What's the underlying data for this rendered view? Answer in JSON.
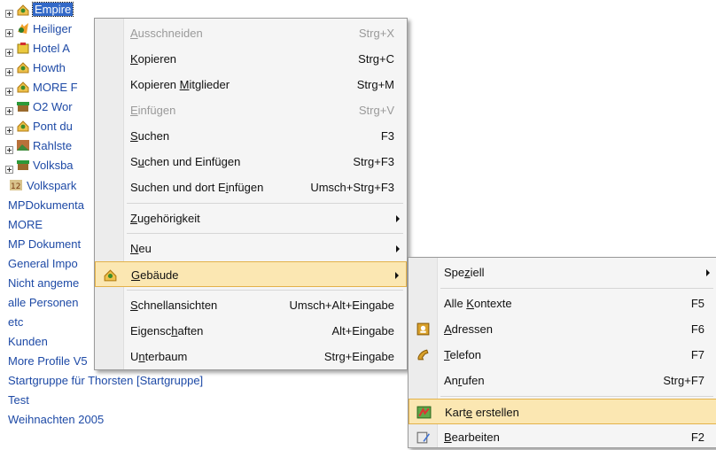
{
  "tree": {
    "items": [
      {
        "label": "Empire",
        "selected": true
      },
      {
        "label": "Heiliger"
      },
      {
        "label": "Hotel A"
      },
      {
        "label": "Howth"
      },
      {
        "label": "MORE F"
      },
      {
        "label": "O2 Wor"
      },
      {
        "label": "Pont du"
      },
      {
        "label": "Rahlste"
      },
      {
        "label": "Volksba"
      },
      {
        "label": "Volkspark"
      },
      {
        "label": "MPDokumenta"
      },
      {
        "label": "MORE"
      },
      {
        "label": "MP Dokument"
      },
      {
        "label": "General Impo"
      },
      {
        "label": "Nicht angeme"
      },
      {
        "label": "alle Personen"
      },
      {
        "label": "etc"
      },
      {
        "label": "Kunden"
      },
      {
        "label": "More Profile V5"
      },
      {
        "label": "Startgruppe für Thorsten [Startgruppe]"
      },
      {
        "label": "Test"
      },
      {
        "label": "Weihnachten 2005"
      }
    ]
  },
  "context_menu": {
    "items": [
      {
        "label_pre": "",
        "label_u": "A",
        "label_post": "usschneiden",
        "shortcut": "Strg+X",
        "disabled": true
      },
      {
        "label_pre": "",
        "label_u": "K",
        "label_post": "opieren",
        "shortcut": "Strg+C"
      },
      {
        "label_pre": "Kopieren ",
        "label_u": "M",
        "label_post": "itglieder",
        "shortcut": "Strg+M"
      },
      {
        "label_pre": "",
        "label_u": "E",
        "label_post": "infügen",
        "shortcut": "Strg+V",
        "disabled": true
      },
      {
        "label_pre": "",
        "label_u": "S",
        "label_post": "uchen",
        "shortcut": "F3"
      },
      {
        "label_pre": "S",
        "label_u": "u",
        "label_post": "chen und Einfügen",
        "shortcut": "Strg+F3"
      },
      {
        "label_pre": "Suchen und dort E",
        "label_u": "i",
        "label_post": "nfügen",
        "shortcut": "Umsch+Strg+F3"
      },
      {
        "label_pre": "",
        "label_u": "Z",
        "label_post": "ugehörigkeit",
        "shortcut": ""
      },
      {
        "label_pre": "",
        "label_u": "N",
        "label_post": "eu",
        "shortcut": ""
      },
      {
        "label_pre": "",
        "label_u": "G",
        "label_post": "ebäude",
        "shortcut": ""
      },
      {
        "label_pre": "",
        "label_u": "S",
        "label_post": "chnellansichten",
        "shortcut": "Umsch+Alt+Eingabe"
      },
      {
        "label_pre": "Eigensc",
        "label_u": "h",
        "label_post": "aften",
        "shortcut": "Alt+Eingabe"
      },
      {
        "label_pre": "U",
        "label_u": "n",
        "label_post": "terbaum",
        "shortcut": "Strg+Eingabe"
      }
    ]
  },
  "submenu": {
    "items": [
      {
        "label_pre": "Spe",
        "label_u": "z",
        "label_post": "iell",
        "shortcut": ""
      },
      {
        "label_pre": "Alle ",
        "label_u": "K",
        "label_post": "ontexte",
        "shortcut": "F5"
      },
      {
        "label_pre": "",
        "label_u": "A",
        "label_post": "dressen",
        "shortcut": "F6"
      },
      {
        "label_pre": "",
        "label_u": "T",
        "label_post": "elefon",
        "shortcut": "F7"
      },
      {
        "label_pre": "An",
        "label_u": "r",
        "label_post": "ufen",
        "shortcut": "Strg+F7"
      },
      {
        "label_pre": "Kart",
        "label_u": "e",
        "label_post": " erstellen",
        "shortcut": ""
      },
      {
        "label_pre": "",
        "label_u": "B",
        "label_post": "earbeiten",
        "shortcut": "F2"
      }
    ]
  },
  "colors": {
    "selection": "#3369c8",
    "menu_highlight": "#fbe7b2",
    "tree_text": "#1e4aa6"
  }
}
